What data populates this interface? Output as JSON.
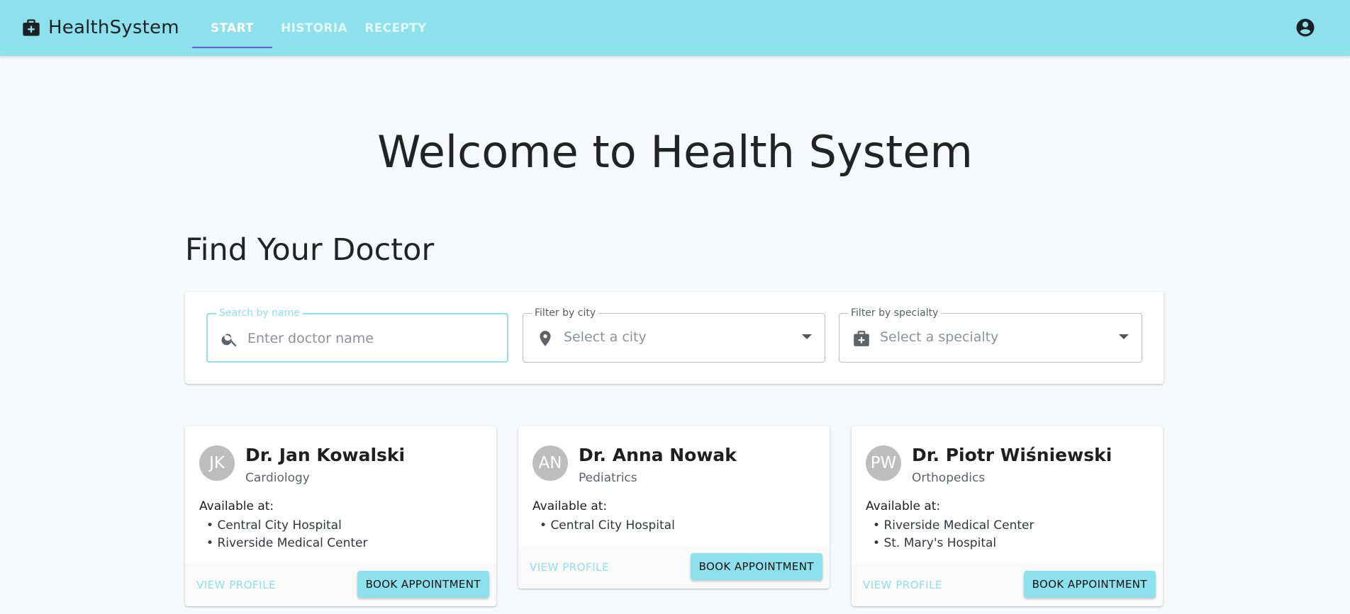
{
  "app": {
    "brand": "HealthSystem",
    "accent_color": "#8ce1ec",
    "brand_icon": "medical-bag-icon",
    "account_icon": "account-circle-icon"
  },
  "nav": {
    "tabs": [
      {
        "label": "START",
        "active": true
      },
      {
        "label": "HISTORIA",
        "active": false
      },
      {
        "label": "RECEPTY",
        "active": false
      }
    ]
  },
  "main": {
    "welcome": "Welcome to Health System",
    "find_title": "Find Your Doctor"
  },
  "filters": {
    "search": {
      "label": "Search by name",
      "placeholder": "Enter doctor name",
      "value": "",
      "icon": "search-icon"
    },
    "city": {
      "label": "Filter by city",
      "value": "Select a city",
      "icon": "location-pin-icon"
    },
    "specialty": {
      "label": "Filter by specialty",
      "value": "Select a specialty",
      "icon": "medical-bag-icon"
    }
  },
  "doctors": [
    {
      "initials": "JK",
      "name": "Dr. Jan Kowalski",
      "specialty": "Cardiology",
      "available_label": "Available at:",
      "locations": [
        "Central City Hospital",
        "Riverside Medical Center"
      ],
      "view_label": "VIEW PROFILE",
      "book_label": "BOOK APPOINTMENT"
    },
    {
      "initials": "AN",
      "name": "Dr. Anna Nowak",
      "specialty": "Pediatrics",
      "available_label": "Available at:",
      "locations": [
        "Central City Hospital"
      ],
      "view_label": "VIEW PROFILE",
      "book_label": "BOOK APPOINTMENT"
    },
    {
      "initials": "PW",
      "name": "Dr. Piotr Wiśniewski",
      "specialty": "Orthopedics",
      "available_label": "Available at:",
      "locations": [
        "Riverside Medical Center",
        "St. Mary's Hospital"
      ],
      "view_label": "VIEW PROFILE",
      "book_label": "BOOK APPOINTMENT"
    }
  ]
}
